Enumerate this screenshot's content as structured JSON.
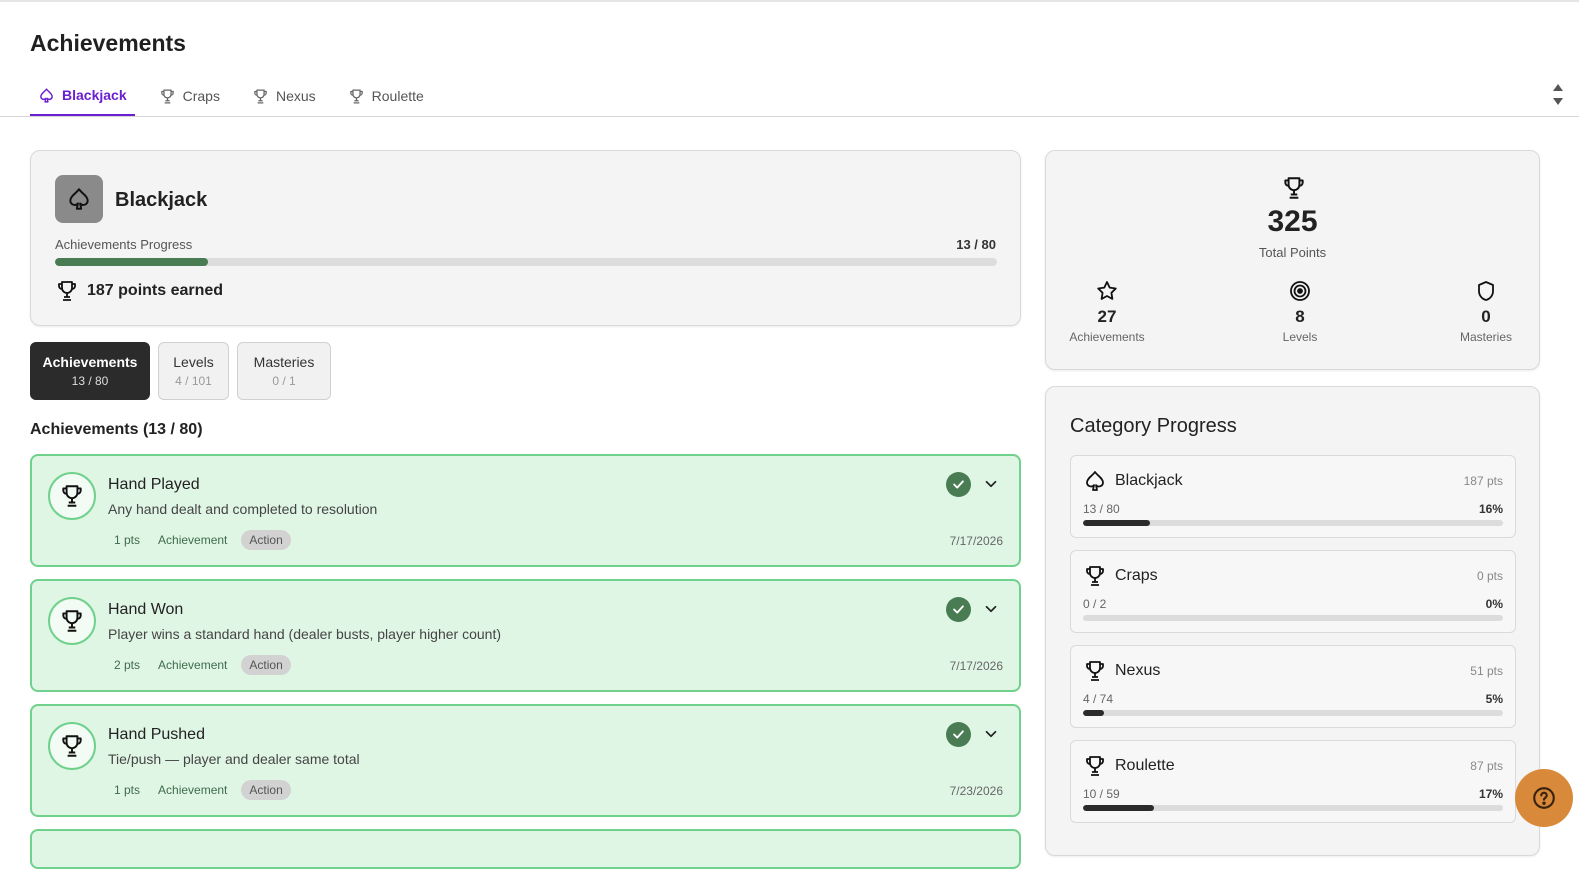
{
  "page": {
    "title": "Achievements"
  },
  "tabs": [
    {
      "label": "Blackjack",
      "icon": "spade-icon",
      "active": true
    },
    {
      "label": "Craps",
      "icon": "trophy-icon"
    },
    {
      "label": "Nexus",
      "icon": "trophy-icon"
    },
    {
      "label": "Roulette",
      "icon": "trophy-icon"
    }
  ],
  "game": {
    "name": "Blackjack",
    "progress_label": "Achievements Progress",
    "progress_count": "13 / 80",
    "progress_fraction": 0.1625,
    "points_earned": "187 points earned"
  },
  "subtabs": [
    {
      "label": "Achievements",
      "count": "13 / 80",
      "active": true
    },
    {
      "label": "Levels",
      "count": "4 / 101"
    },
    {
      "label": "Masteries",
      "count": "0 / 1"
    }
  ],
  "list": {
    "heading": "Achievements (13 / 80)",
    "items": [
      {
        "title": "Hand Played",
        "description": "Any hand dealt and completed to resolution",
        "points": "1 pts",
        "type": "Achievement",
        "tag": "Action",
        "date": "7/17/2026"
      },
      {
        "title": "Hand Won",
        "description": "Player wins a standard hand (dealer busts, player higher count)",
        "points": "2 pts",
        "type": "Achievement",
        "tag": "Action",
        "date": "7/17/2026"
      },
      {
        "title": "Hand Pushed",
        "description": "Tie/push — player and dealer same total",
        "points": "1 pts",
        "type": "Achievement",
        "tag": "Action",
        "date": "7/23/2026"
      }
    ]
  },
  "stats": {
    "total_points": "325",
    "total_label": "Total Points",
    "achievements_value": "27",
    "achievements_label": "Achievements",
    "levels_value": "8",
    "levels_label": "Levels",
    "masteries_value": "0",
    "masteries_label": "Masteries"
  },
  "categories": {
    "title": "Category Progress",
    "items": [
      {
        "name": "Blackjack",
        "icon": "spade-icon",
        "points": "187 pts",
        "count": "13 / 80",
        "percent": "16%",
        "fraction": 0.16
      },
      {
        "name": "Craps",
        "icon": "trophy-icon",
        "points": "0 pts",
        "count": "0 / 2",
        "percent": "0%",
        "fraction": 0
      },
      {
        "name": "Nexus",
        "icon": "trophy-icon",
        "points": "51 pts",
        "count": "4 / 74",
        "percent": "5%",
        "fraction": 0.05
      },
      {
        "name": "Roulette",
        "icon": "trophy-icon",
        "points": "87 pts",
        "count": "10 / 59",
        "percent": "17%",
        "fraction": 0.17
      }
    ]
  },
  "colors": {
    "accent": "#6a1fd0",
    "success_bg": "#e0f6e5",
    "success_border": "#6fd18b",
    "progress_fill": "#4a7c53",
    "dark_fill": "#2b2b2b",
    "help_button": "#d88a3a"
  }
}
